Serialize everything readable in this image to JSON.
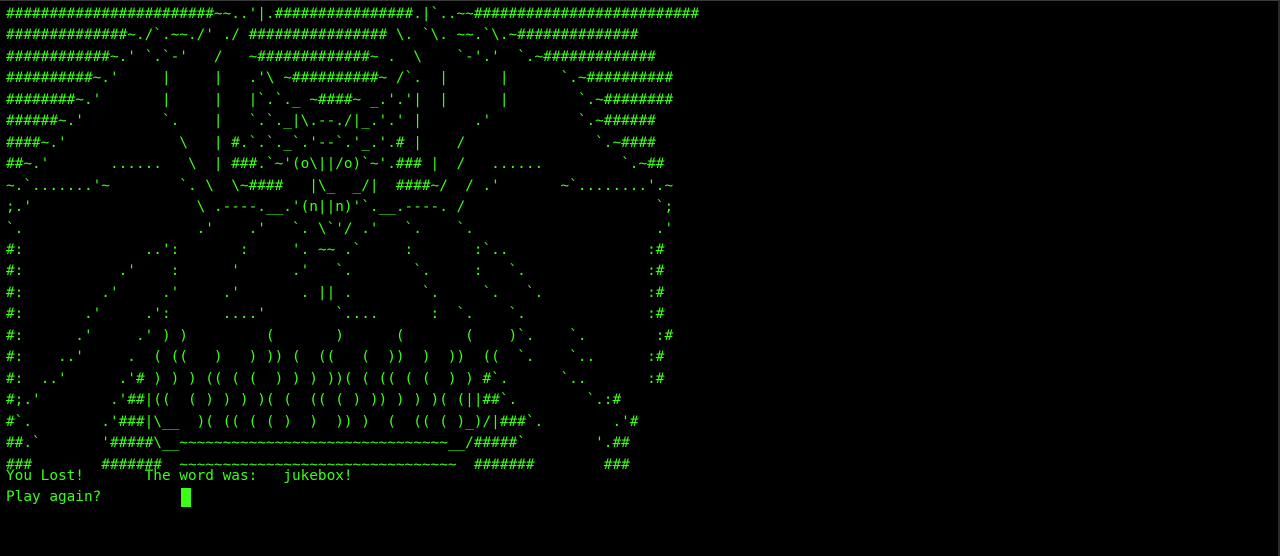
{
  "terminal": {
    "fg_color": "#39ff14",
    "bg_color": "#000000",
    "ascii_art": [
      "########################~~..'|.################.|`..~~##########################",
      "##############~./`.~~./' ./ ################ \\. `\\. ~~.`\\.~##############",
      "############~.' `.`-'   /   ~#############~ .  \\    `-'.'  `.~#############",
      "##########~.'     |     |   .'\\ ~##########~ /`.  |      |      `.~##########",
      "########~.'       |     |   |`.`._ ~####~ _.'.'|  |      |        `.~########",
      "######~.'         `.    |   `.`._|\\.--./|_.'.' |      .'          `.~######",
      "####~.'             \\   | #.`.`._`.'--`.'_.'.# |    /               `.~####",
      "##~.'       ......   \\  | ###.`~'(o\\||/o)`~'.### |  /   ......         `.~##",
      "~.`.......'~        `. \\  \\~####   |\\_  _/|  ####~/  / .'       ~`........'.~",
      ";.'                   \\ .----.__.'(n||n)'`.__.----. /                      `;",
      "`.                    .'    .'   `. \\`'/ .'   `.    `.                     .'",
      "#:              ..':       :     '. ~~ .`     :       :`..                :#",
      "#:           .'    :      '      .'   `.       `.     :   `.              :#",
      "#:         .'     .'     .'       . || .        `.     `.   `.            :#",
      "#:       .'     .':      ....'        `....      :  `.    `.              :#",
      "#:      .'     .' ) )         (       )      (       (    )`.    `.        :#",
      "#:    ..'     .  ( ((   )   ) )) (  ((   (  ))  )  ))  ((  `.    `..      :#",
      "#:  ..'      .'# ) ) ) (( ( (  ) ) ) ))( ( (( ( (  ) ) #`.      `..       :#",
      "#;.'        .'##|((  ( ) ) ) )( (  (( ( ) )) ) ) )( (||##`.        `.:#",
      "#`.        .'###|\\__  )( (( ( ( )  )  )) )  (  (( ( )_)/|###`.        .'#",
      "##.`       '#####\\__~~~~~~~~~~~~~~~~~~~~~~~~~~~~~~~__/#####`        '.##",
      "###        #######  ~~~~~~~~~~~~~~~~~~~~~~~~~~~~~~~~  #######        ###"
    ],
    "status": {
      "lost_text": "You Lost!",
      "word_label": "The word was:",
      "word": "jukebox!"
    },
    "prompt_text": "Play again?"
  }
}
